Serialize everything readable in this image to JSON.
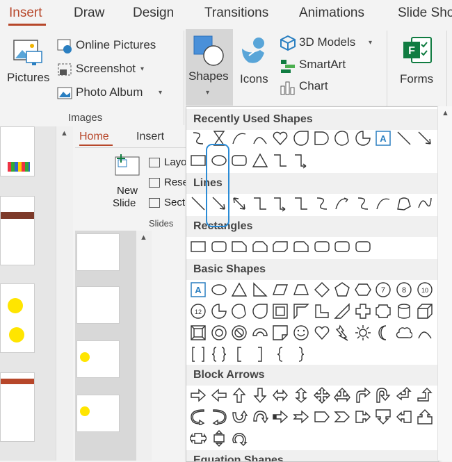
{
  "tabs": [
    {
      "label": "Insert",
      "active": true
    },
    {
      "label": "Draw"
    },
    {
      "label": "Design"
    },
    {
      "label": "Transitions"
    },
    {
      "label": "Animations"
    },
    {
      "label": "Slide Sho"
    }
  ],
  "ribbon": {
    "pictures": "Pictures",
    "online_pictures": "Online Pictures",
    "screenshot": "Screenshot",
    "photo_album": "Photo Album",
    "images_group": "Images",
    "shapes": "Shapes",
    "icons": "Icons",
    "models_3d": "3D Models",
    "smartart": "SmartArt",
    "chart": "Chart",
    "forms": "Forms"
  },
  "second_window": {
    "tab_home": "Home",
    "tab_insert": "Insert",
    "new_slide_1": "New",
    "new_slide_2": "Slide",
    "layout": "Layo",
    "reset": "Rese",
    "section": "Sect",
    "slides_group": "Slides"
  },
  "shapes_panel": {
    "categories": [
      "Recently Used Shapes",
      "Lines",
      "Rectangles",
      "Basic Shapes",
      "Block Arrows",
      "Equation Shapes"
    ]
  },
  "colors": {
    "accent": "#b7472a",
    "highlight": "#2a8bd6",
    "shapes_icon": "#4a90d9",
    "forms_green": "#107c41"
  }
}
